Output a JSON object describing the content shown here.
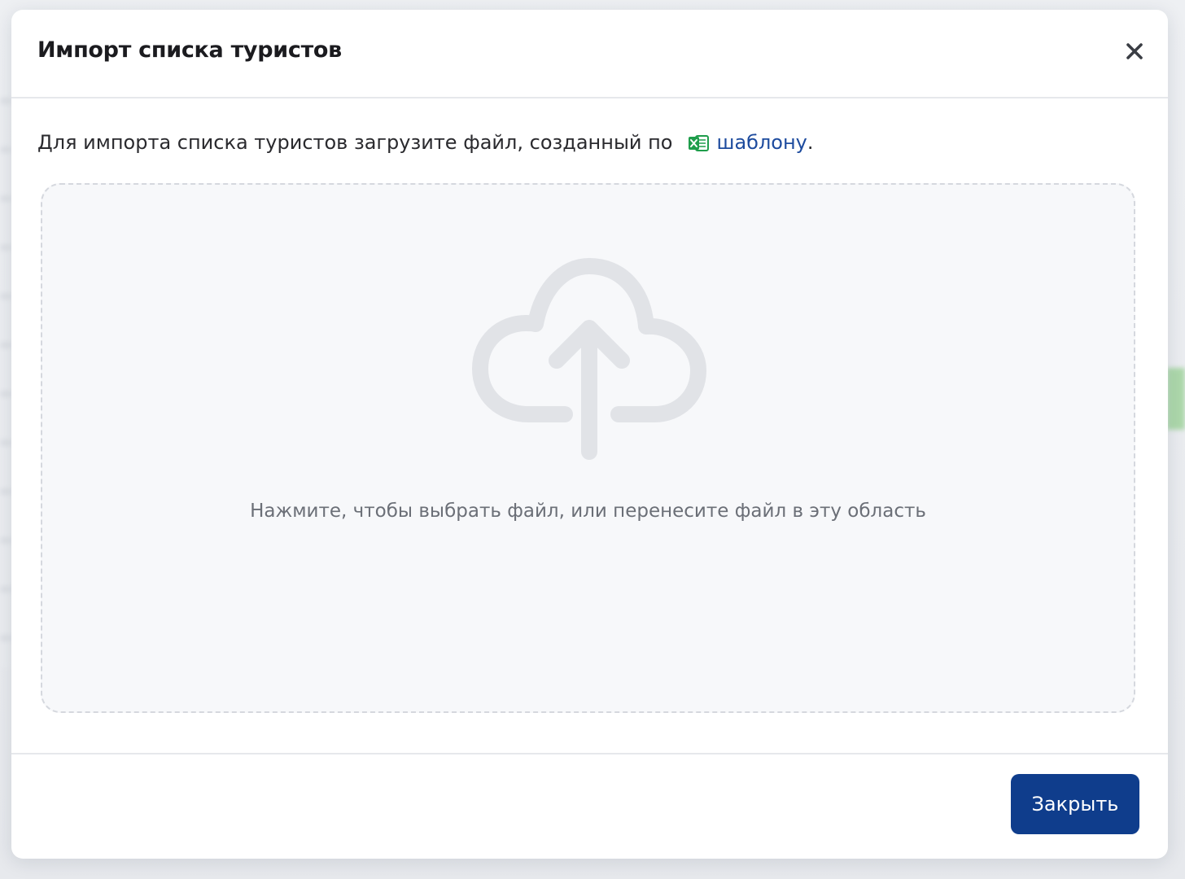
{
  "modal": {
    "title": "Импорт списка туристов",
    "close_icon": "close-icon"
  },
  "intro": {
    "text": "Для импорта списка туристов загрузите файл, созданный по",
    "file_icon": "excel-file-icon",
    "link_text": "шаблону",
    "trailing": "."
  },
  "dropzone": {
    "icon": "cloud-upload-icon",
    "text": "Нажмите, чтобы выбрать файл, или перенесите файл в эту область"
  },
  "footer": {
    "close_label": "Закрыть"
  },
  "colors": {
    "primary": "#0f3d8c",
    "link": "#1d4b9e",
    "excel_green": "#1f9d4b",
    "dropzone_bg": "#f7f8fa"
  }
}
